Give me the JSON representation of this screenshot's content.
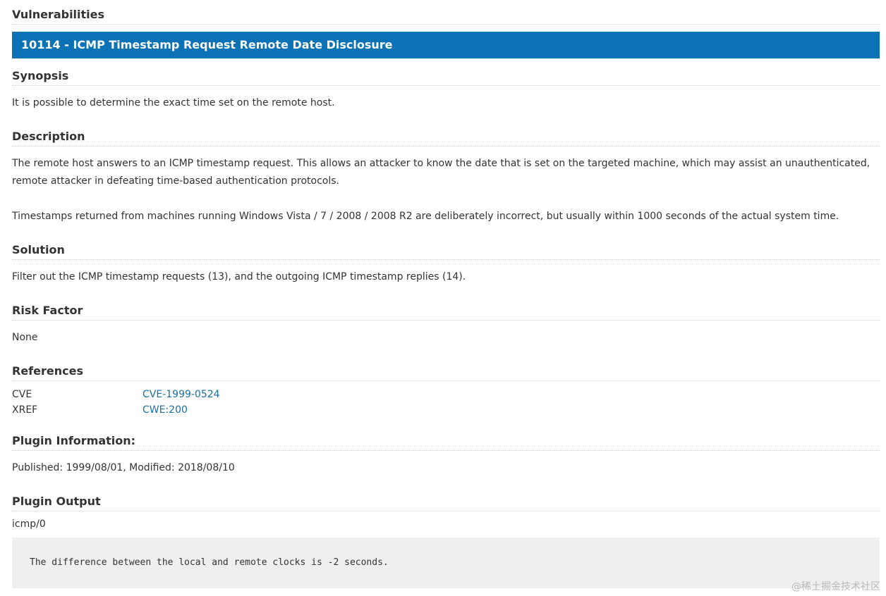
{
  "page": {
    "section_title": "Vulnerabilities"
  },
  "vulnerability": {
    "title": "10114 - ICMP Timestamp Request Remote Date Disclosure",
    "banner_color": "#0b72b5",
    "synopsis": {
      "heading": "Synopsis",
      "text": "It is possible to determine the exact time set on the remote host."
    },
    "description": {
      "heading": "Description",
      "paragraph1": "The remote host answers to an ICMP timestamp request. This allows an attacker to know the date that is set on the targeted machine, which may assist an unauthenticated, remote attacker in defeating time-based authentication protocols.",
      "paragraph2": "Timestamps returned from machines running Windows Vista / 7 / 2008 / 2008 R2 are deliberately incorrect, but usually within 1000 seconds of the actual system time."
    },
    "solution": {
      "heading": "Solution",
      "text": "Filter out the ICMP timestamp requests (13), and the outgoing ICMP timestamp replies (14)."
    },
    "risk_factor": {
      "heading": "Risk Factor",
      "text": "None"
    },
    "references": {
      "heading": "References",
      "items": [
        {
          "key": "CVE",
          "value": "CVE-1999-0524"
        },
        {
          "key": "XREF",
          "value": "CWE:200"
        }
      ],
      "link_color": "#1a6fa3"
    },
    "plugin_information": {
      "heading": "Plugin Information:",
      "text": "Published: 1999/08/01, Modified: 2018/08/10"
    },
    "plugin_output": {
      "heading": "Plugin Output",
      "port": "icmp/0",
      "output": "The difference between the local and remote clocks is -2 seconds."
    }
  },
  "watermark": "@稀土掘金技术社区"
}
